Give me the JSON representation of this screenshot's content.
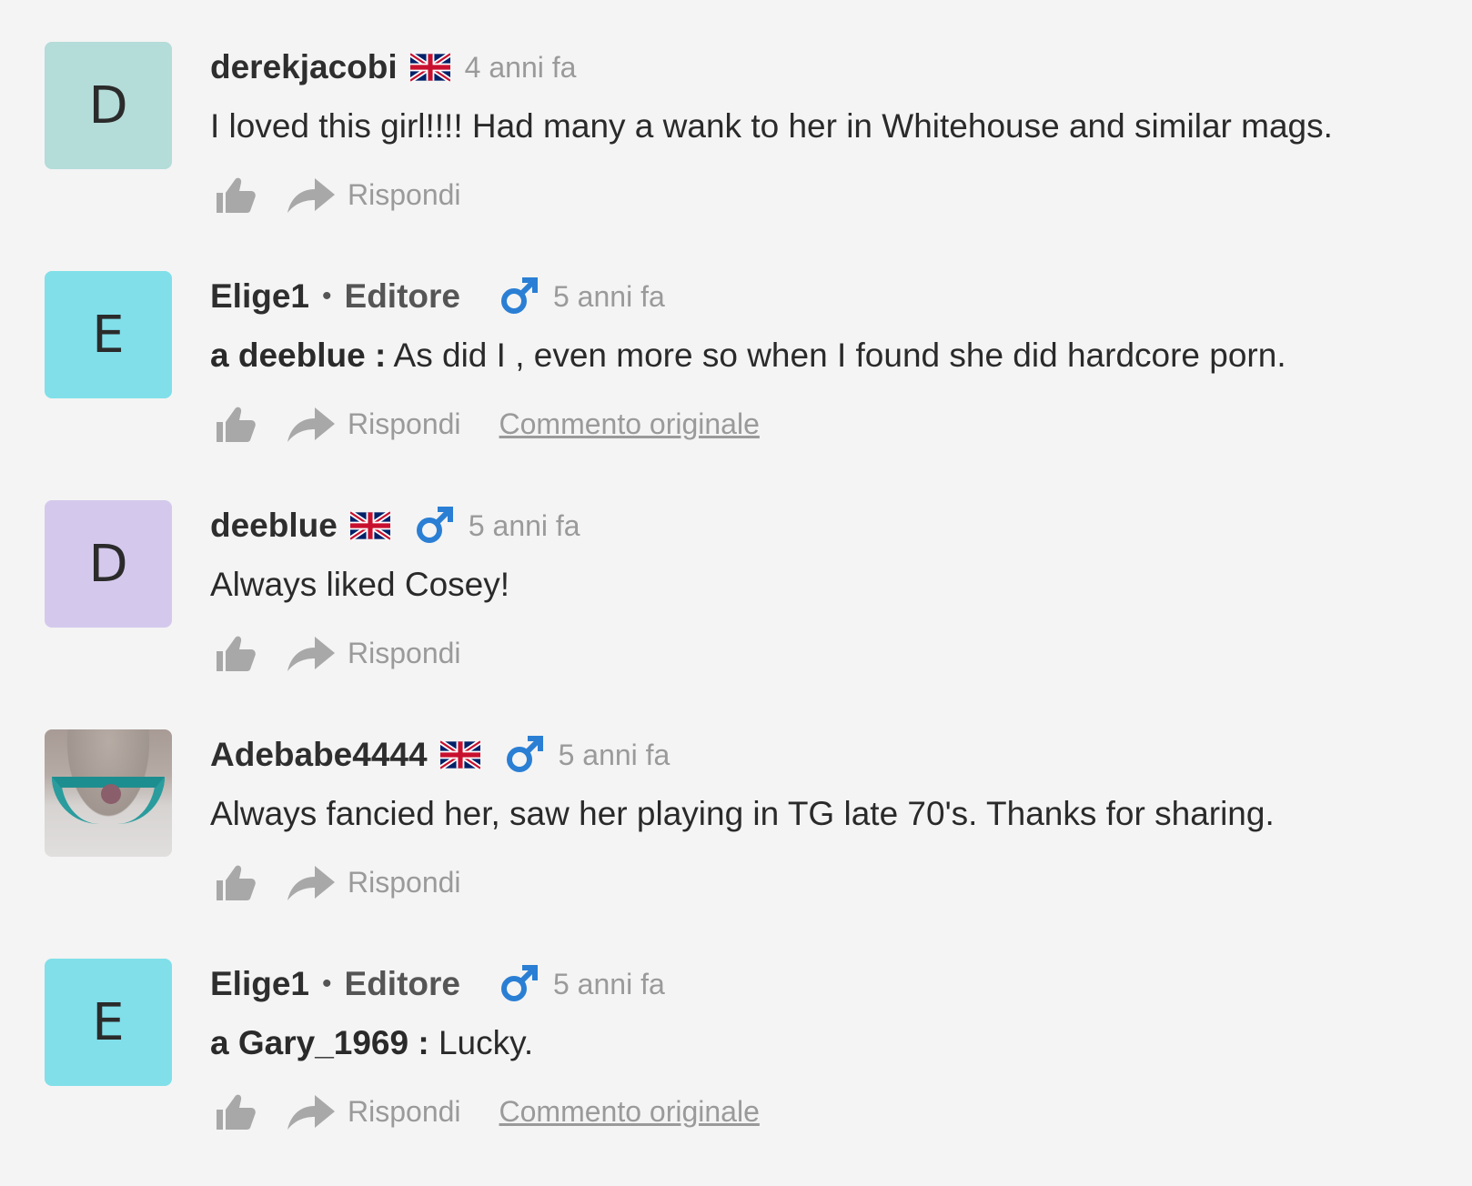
{
  "colors": {
    "background": "#f4f4f4",
    "meta_gray": "#9a9a9a",
    "gender_blue": "#2a7fd4"
  },
  "comments": [
    {
      "avatar_letter": "D",
      "avatar_color": "#b4dcd9",
      "username": "derekjacobi",
      "flag": "uk-flag-icon",
      "time": "4 anni fa",
      "mention": "",
      "text": "I loved this girl!!!! Had many a wank to her in Whitehouse and similar mags.",
      "reply_label": "Rispondi"
    },
    {
      "avatar_letter": "E",
      "avatar_color": "#80dfe9",
      "username": "Elige1",
      "separator": "•",
      "role": "Editore",
      "gender": "male-icon",
      "time": "5 anni fa",
      "mention": "a deeblue :",
      "text": "As did I , even more so when I found she did hardcore porn.",
      "reply_label": "Rispondi",
      "original_label": "Commento originale"
    },
    {
      "avatar_letter": "D",
      "avatar_color": "#d4c9ec",
      "username": "deeblue",
      "flag": "uk-flag-icon",
      "gender": "male-icon",
      "time": "5 anni fa",
      "mention": "",
      "text": "Always liked Cosey!",
      "reply_label": "Rispondi"
    },
    {
      "avatar_image": "user-photo",
      "username": "Adebabe4444",
      "flag": "uk-flag-icon",
      "gender": "male-icon",
      "time": "5 anni fa",
      "mention": "",
      "text": "Always fancied her, saw her playing in TG late 70's. Thanks for sharing.",
      "reply_label": "Rispondi"
    },
    {
      "avatar_letter": "E",
      "avatar_color": "#80dfe9",
      "username": "Elige1",
      "separator": "•",
      "role": "Editore",
      "gender": "male-icon",
      "time": "5 anni fa",
      "mention": "a Gary_1969 :",
      "text": "Lucky.",
      "reply_label": "Rispondi",
      "original_label": "Commento originale"
    }
  ]
}
